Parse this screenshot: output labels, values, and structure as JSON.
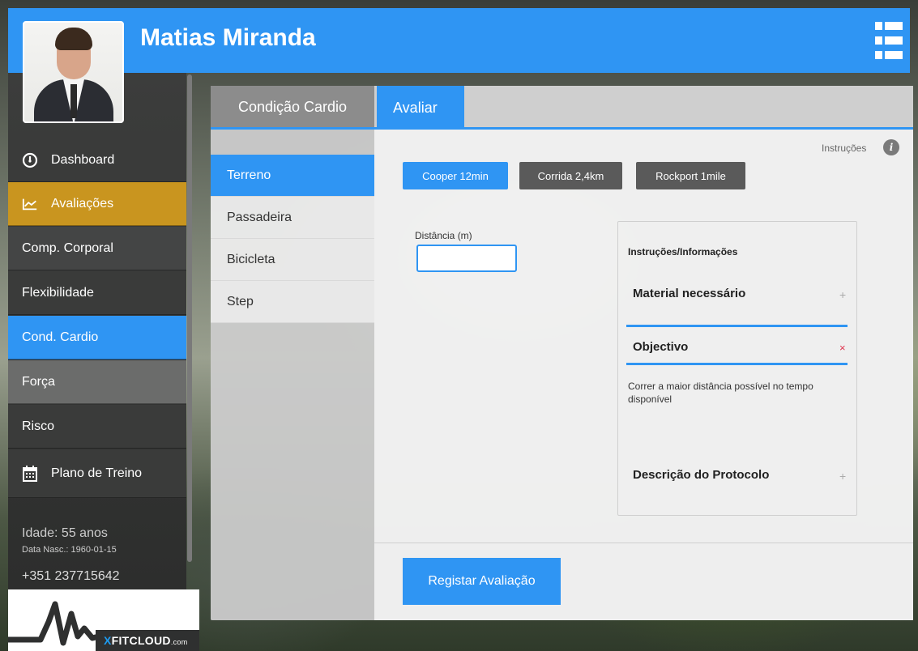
{
  "header": {
    "user_name": "Matias Miranda",
    "menu_icon": "list-icon"
  },
  "sidebar": {
    "items": [
      {
        "label": "Dashboard",
        "icon": "gauge-icon"
      },
      {
        "label": "Avaliações",
        "icon": "chart-line-icon"
      },
      {
        "label": "Comp. Corporal"
      },
      {
        "label": "Flexibilidade"
      },
      {
        "label": "Cond. Cardio"
      },
      {
        "label": "Força"
      },
      {
        "label": "Risco"
      },
      {
        "label": "Plano de Treino",
        "icon": "calendar-icon"
      }
    ],
    "age": "Idade: 55 anos",
    "dob": "Data Nasc.: 1960-01-15",
    "phone": "+351 237715642",
    "logo": {
      "x": "X",
      "rest": "FITCLOUD",
      "com": ".com"
    }
  },
  "tabs": {
    "section": "Condição Cardio",
    "active": "Avaliar"
  },
  "subnav": [
    "Terreno",
    "Passadeira",
    "Bicicleta",
    "Step"
  ],
  "content": {
    "instructions_link": "Instruções",
    "info_icon": "i",
    "tests": [
      "Cooper 12min",
      "Corrida 2,4km",
      "Rockport 1mile"
    ],
    "distance_label": "Distância (m)",
    "distance_value": "",
    "info_box": {
      "title": "Instruções/Informações",
      "sections": [
        {
          "title": "Material necessário",
          "sign": "+"
        },
        {
          "title": "Objectivo",
          "sign": "×",
          "text": "Correr a maior distância possível no tempo disponível"
        },
        {
          "title": "Descrição do Protocolo",
          "sign": "+"
        }
      ]
    },
    "register_label": "Registar Avaliação"
  },
  "colors": {
    "accent": "#2f95f3",
    "gold": "#c9951f",
    "sidebar": "#3c3d3c"
  }
}
